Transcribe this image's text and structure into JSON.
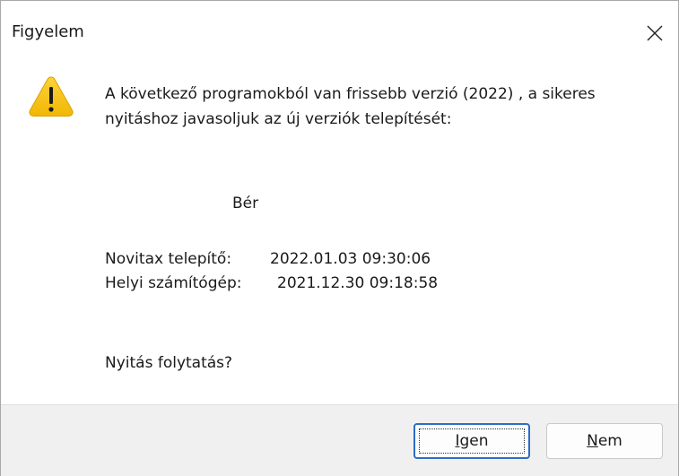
{
  "dialog": {
    "title": "Figyelem",
    "close_icon": "close-icon",
    "warning_icon": "warning-triangle-icon",
    "message": "A következő programokból van frissebb verzió (2022) , a sikeres nyitáshoz javasoljuk az új verziók telepítését:",
    "program_name": "Bér",
    "installer_label": "Novitax telepítő:",
    "installer_date": "2022.01.03 09:30:06",
    "local_label": "Helyi számítógép:",
    "local_date": "2021.12.30 09:18:58",
    "question": "Nyitás folytatás?"
  },
  "buttons": {
    "yes_label": "Igen",
    "no_label": "Nem"
  },
  "colors": {
    "accent": "#2c6dc8",
    "warning_fill": "#f7c31a",
    "footer_bg": "#f0f0f0"
  }
}
